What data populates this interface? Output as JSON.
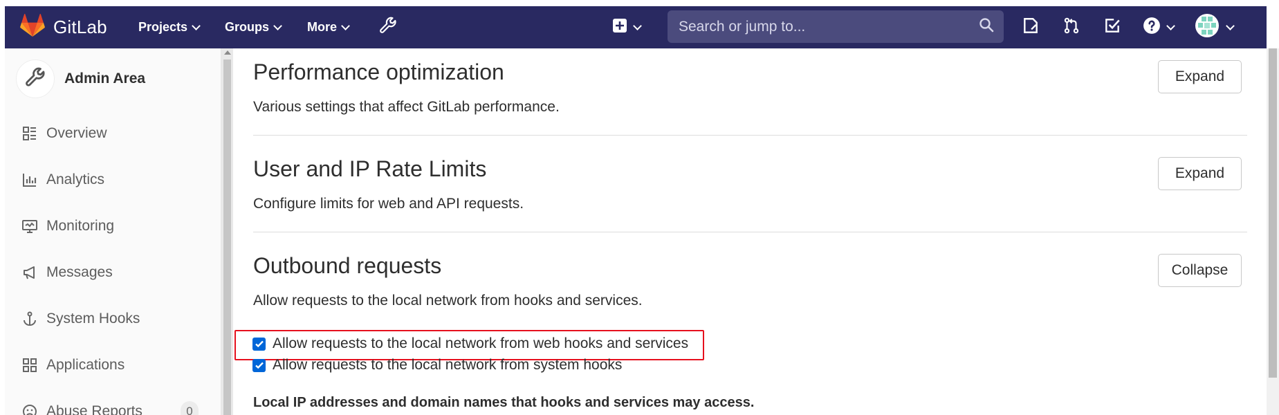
{
  "navbar": {
    "brand": "GitLab",
    "projects": "Projects",
    "groups": "Groups",
    "more": "More",
    "search_placeholder": "Search or jump to..."
  },
  "sidebar": {
    "title": "Admin Area",
    "items": [
      {
        "label": "Overview"
      },
      {
        "label": "Analytics"
      },
      {
        "label": "Monitoring"
      },
      {
        "label": "Messages"
      },
      {
        "label": "System Hooks"
      },
      {
        "label": "Applications"
      },
      {
        "label": "Abuse Reports",
        "count": "0"
      }
    ]
  },
  "sections": [
    {
      "title": "Performance optimization",
      "description": "Various settings that affect GitLab performance.",
      "button": "Expand"
    },
    {
      "title": "User and IP Rate Limits",
      "description": "Configure limits for web and API requests.",
      "button": "Expand"
    },
    {
      "title": "Outbound requests",
      "description": "Allow requests to the local network from hooks and services.",
      "button": "Collapse"
    }
  ],
  "outbound": {
    "checkbox_web_hooks": "Allow requests to the local network from web hooks and services",
    "checkbox_system_hooks": "Allow requests to the local network from system hooks",
    "allowlist_label": "Local IP addresses and domain names that hooks and services may access."
  },
  "colors": {
    "navbar_bg": "#292961",
    "checkbox_blue": "#0066d8",
    "highlight_red": "#e6101d"
  }
}
